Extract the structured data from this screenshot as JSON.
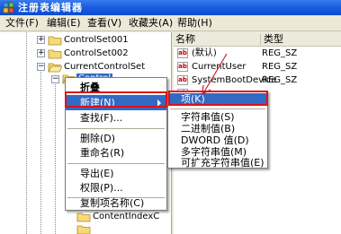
{
  "window": {
    "title": "注册表编辑器",
    "app_icon": "registry-editor-icon"
  },
  "menubar": {
    "items": [
      {
        "label": "文件(F)"
      },
      {
        "label": "编辑(E)"
      },
      {
        "label": "查看(V)"
      },
      {
        "label": "收藏夹(A)"
      },
      {
        "label": "帮助(H)"
      }
    ]
  },
  "tree": {
    "nodes": [
      {
        "label": "ControlSet001"
      },
      {
        "label": "ControlSet002"
      },
      {
        "label": "CurrentControlSet"
      },
      {
        "label": "Control"
      },
      {
        "label": "ContentIndexC"
      }
    ]
  },
  "list": {
    "columns": {
      "name": "名称",
      "type": "类型"
    },
    "rows": [
      {
        "name": "(默认)",
        "type": "REG_SZ"
      },
      {
        "name": "CurrentUser",
        "type": "REG_SZ"
      },
      {
        "name": "SystemBootDevice",
        "type": "REG_SZ"
      }
    ]
  },
  "context_menu": {
    "items": [
      {
        "label": "折叠"
      },
      {
        "label": "新建(N)"
      },
      {
        "label": "查找(F)..."
      },
      {
        "label": "删除(D)"
      },
      {
        "label": "重命名(R)"
      },
      {
        "label": "导出(E)"
      },
      {
        "label": "权限(P)..."
      },
      {
        "label": "复制项名称(C)"
      }
    ]
  },
  "submenu": {
    "items": [
      {
        "label": "项(K)"
      },
      {
        "label": "字符串值(S)"
      },
      {
        "label": "二进制值(B)"
      },
      {
        "label": "DWORD 值(D)"
      },
      {
        "label": "多字符串值(M)"
      },
      {
        "label": "可扩充字符串值(E)"
      }
    ]
  },
  "colors": {
    "title_bar": "#0a4bd0",
    "selection": "#316ac5",
    "annotation_red": "#e0101a",
    "menu_background": "#ece9d8"
  }
}
